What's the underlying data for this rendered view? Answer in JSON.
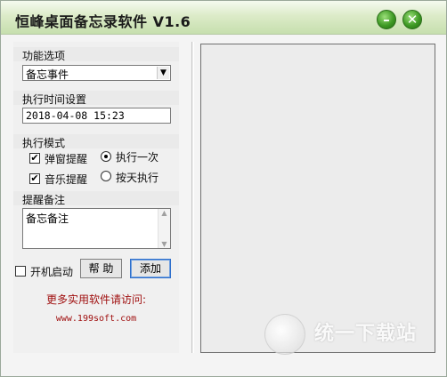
{
  "window": {
    "title": "恒峰桌面备忘录软件 V1.6",
    "minimize_glyph": "–",
    "close_glyph": "✕"
  },
  "function": {
    "label": "功能选项",
    "selected": "备忘事件"
  },
  "time": {
    "label": "执行时间设置",
    "value": "2018-04-08 15:23"
  },
  "mode": {
    "label": "执行模式",
    "popup_label": "弹窗提醒",
    "popup_checked": true,
    "music_label": "音乐提醒",
    "music_checked": true,
    "once_label": "执行一次",
    "once_selected": true,
    "daily_label": "按天执行",
    "daily_selected": false
  },
  "note": {
    "label": "提醒备注",
    "value": "备忘备注"
  },
  "bottom": {
    "autostart_label": "开机启动",
    "autostart_checked": false,
    "help_label": "帮 助",
    "add_label": "添加"
  },
  "footer": {
    "more_text": "更多实用软件请访问:",
    "url": "www.199soft.com"
  },
  "watermark": {
    "text": "统一下载站"
  }
}
